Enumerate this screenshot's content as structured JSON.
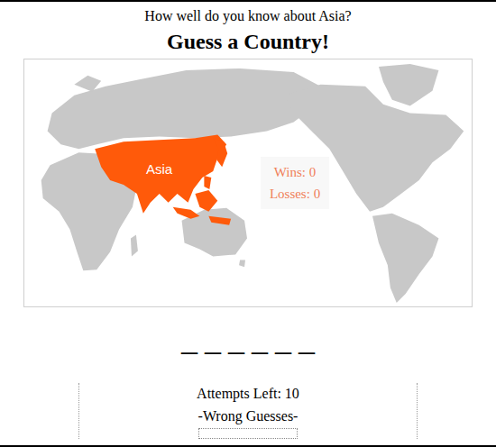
{
  "header": {
    "subtitle": "How well do you know about Asia?",
    "title": "Guess a Country!"
  },
  "map": {
    "region_label": "Asia"
  },
  "score": {
    "wins": "Wins: 0",
    "losses": "Losses: 0"
  },
  "word": {
    "blanks": [
      "_",
      "_",
      "_",
      "_",
      "_",
      "_"
    ]
  },
  "status": {
    "attempts": "Attempts Left: 10",
    "wrong_heading": "-Wrong Guesses-",
    "wrong_guesses": []
  }
}
